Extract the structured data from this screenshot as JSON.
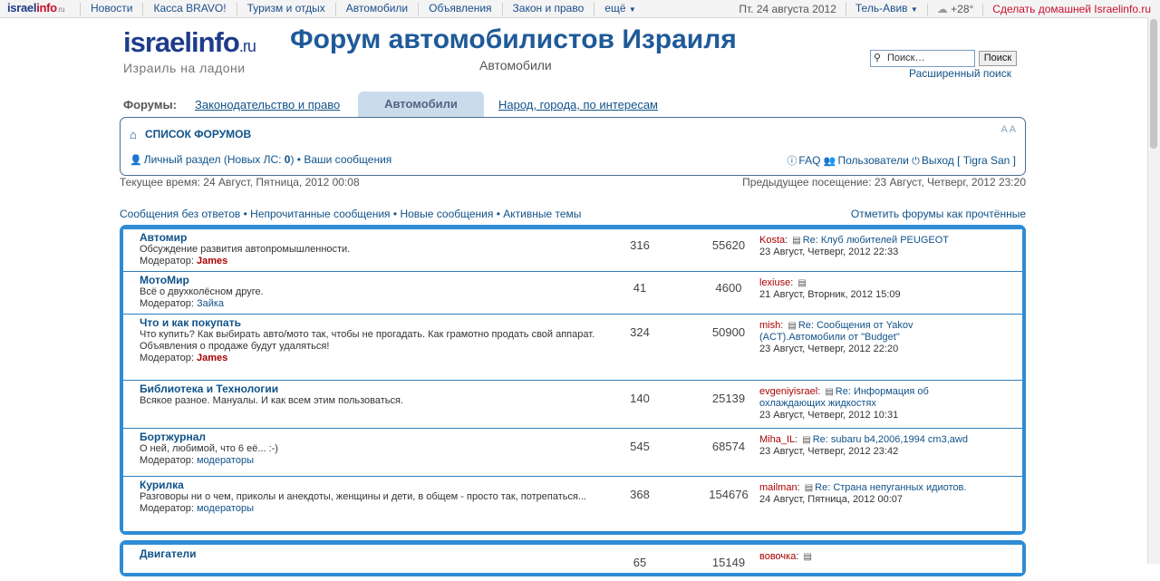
{
  "topbar": {
    "logo_a": "israel",
    "logo_b": "info",
    "logo_ru": ".ru",
    "nav": [
      {
        "label": "Новости"
      },
      {
        "label": "Касса BRAVO!"
      },
      {
        "label": "Туризм и отдых"
      },
      {
        "label": "Автомобили"
      },
      {
        "label": "Объявления"
      },
      {
        "label": "Закон и право"
      },
      {
        "label": "ещё"
      }
    ],
    "date": "Пт. 24 августа 2012",
    "city": "Тель-Авив",
    "weather": "+28°",
    "homepage": "Сделать домашней Israelinfo.ru"
  },
  "header": {
    "brand": "israelinfo",
    "brand_ru": ".ru",
    "slogan": "Израиль на ладони",
    "title": "Форум автомобилистов Израиля",
    "subtitle": "Автомобили",
    "search_value": "Поиск…",
    "search_button": "Поиск",
    "advanced_search": "Расширенный поиск"
  },
  "tabs": {
    "label": "Форумы:",
    "items": [
      "Законодательство и право",
      "Автомобили",
      "Народ, города, по интересам"
    ]
  },
  "navbar": {
    "index": "СПИСОК ФОРУМОВ",
    "fontsize": "A A",
    "ucp": "Личный раздел",
    "pm_prefix": " (Новых ЛС: ",
    "pm_count": "0",
    "pm_suffix": ") • ",
    "your_posts": "Ваши сообщения",
    "faq": "FAQ",
    "members": "Пользователи",
    "logout": "Выход [ Tigra San ]"
  },
  "times": {
    "current": "Текущее время: 24 Август, Пятница, 2012 00:08",
    "last_visit": "Предыдущее посещение: 23 Август, Четверг, 2012 23:20"
  },
  "quicklinks": {
    "unanswered": "Сообщения без ответов",
    "unread": "Непрочитанные сообщения",
    "new": "Новые сообщения",
    "active": "Активные темы",
    "sep": " • ",
    "mark_read": "Отметить форумы как прочтённые"
  },
  "forums": [
    {
      "name": "Автомир",
      "desc": "Обсуждение развития автопромышленности.",
      "mod_label": "Модератор: ",
      "mod": "James",
      "topics": "316",
      "posts": "55620",
      "author": "Kosta",
      "subject": "Re: Клуб любителей PEUGEOT",
      "time": "23 Август, Четверг, 2012 22:33"
    },
    {
      "name": "МотоМир",
      "desc": "Всё о двухколёсном друге.",
      "mod_label": "Модератор: ",
      "mod": "Зайка",
      "topics": "41",
      "posts": "4600",
      "author": "lexiuse",
      "subject": "",
      "time": "21 Август, Вторник, 2012 15:09"
    },
    {
      "name": "Что и как покупать",
      "desc": "Что купить? Как выбирать авто/мото так, чтобы не прогадать. Как грамотно продать свой аппарат.",
      "desc2": "Объявления о продаже будут удаляться!",
      "mod_label": "Модератор: ",
      "mod": "James",
      "topics": "324",
      "posts": "50900",
      "author": "mish",
      "subject": "Re: Сообщения от Yakov (ACT).Автомобили от \"Budget\"",
      "time": "23 Август, Четверг, 2012 22:20"
    },
    {
      "name": "Библиотека и Технологии",
      "desc": "Всякое разное. Мануалы. И как всем этим пользоваться.",
      "topics": "140",
      "posts": "25139",
      "author": "evgeniyisrael",
      "subject": "Re: Информация об охлаждающих жидкостях",
      "time": "23 Август, Четверг, 2012 10:31"
    },
    {
      "name": "Бортжурнал",
      "desc": "О ней, любимой, что 6 её... :-)",
      "mod_label": "Модератор: ",
      "mod": "модераторы",
      "topics": "545",
      "posts": "68574",
      "author": "Miha_IL",
      "subject": "Re: subaru b4,2006,1994 cm3,awd",
      "time": "23 Август, Четверг, 2012 23:42"
    },
    {
      "name": "Курилка",
      "desc": "Разговоры ни о чем, приколы и анекдоты, женщины и дети, в общем - просто так, потрепаться...",
      "mod_label": "Модератор: ",
      "mod": "модераторы",
      "topics": "368",
      "posts": "154676",
      "author": "mailman",
      "subject": "Re: Страна непуганных идиотов.",
      "time": "24 Август, Пятница, 2012 00:07"
    }
  ],
  "forums2": [
    {
      "name": "Двигатели",
      "topics": "65",
      "posts": "15149",
      "author": "вовочка"
    }
  ]
}
